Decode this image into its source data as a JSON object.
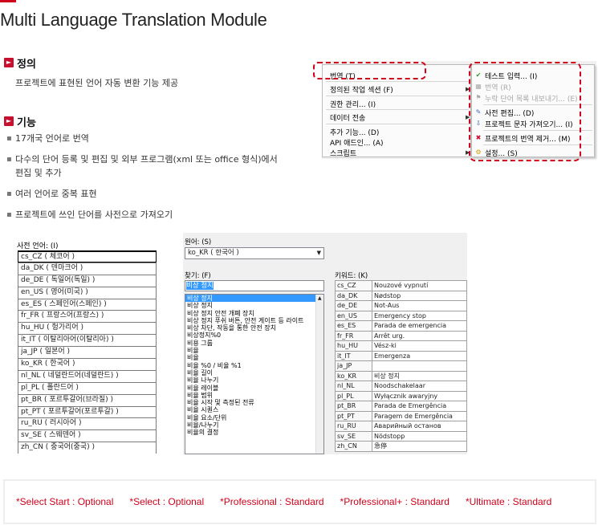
{
  "title": "Multi Language Translation Module",
  "definition": {
    "heading": "정의",
    "text": "프로젝트에 표현된 언어 자동 변환 기능 제공"
  },
  "features": {
    "heading": "기능",
    "items": [
      "17개국 언어로 번역",
      "다수의 단어 등록 및 편집 및 외부 프로그램(xml 또는 office 형식)에서\n편집 및 추가",
      "여러 언어로 중복 표현",
      "프로젝트에 쓰인 단어를 사전으로 가져오기"
    ]
  },
  "menu": {
    "main_items": [
      "번역 (T)",
      "정의된 작업 섹션 (F)",
      "권한 관리... (I)",
      "데이터 전송",
      "추가 기능... (D)",
      "API 애드인... (A)",
      "스크립트"
    ],
    "sub_items": [
      "테스트 입력... (I)",
      "번역 (R)",
      "누락 단어 목록 내보내기... (E)",
      "사전 편집... (D)",
      "프로젝트 문자 가져오기... (I)",
      "프로젝트의 번역 제거... (M)",
      "설정... (S)"
    ]
  },
  "dictionary_languages": {
    "label": "사전 언어: (I)",
    "items": [
      "cs_CZ ( 체코어 )",
      "da_DK ( 덴마크어 )",
      "de_DE ( 독일어(독일) )",
      "en_US ( 영어(미국) )",
      "es_ES ( 스페인어(스페인) )",
      "fr_FR ( 프랑스어(프랑스) )",
      "hu_HU ( 헝가리어 )",
      "it_IT ( 이탈리아어(이탈리아) )",
      "ja_JP ( 일본어 )",
      "ko_KR ( 한국어 )",
      "nl_NL ( 네덜란드어(네덜란드) )",
      "pl_PL ( 폴란드어 )",
      "pt_BR ( 포르투갈어(브라질) )",
      "pt_PT ( 포르투갈어(포르투갈) )",
      "ru_RU ( 러시아어 )",
      "sv_SE ( 스웨덴어 )",
      "zh_CN ( 중국어(중국) )"
    ]
  },
  "dictionary": {
    "source_label": "원어: (S)",
    "source_value": "ko_KR ( 한국어 )",
    "find_label": "찾기: (F)",
    "find_value": "비상 정지",
    "keyword_label": "키워드: (K)",
    "words": [
      "비상 정지",
      "비상 정지",
      "비상 정지 안전 개폐 장치",
      "비상 정지 푸쉬 버튼, 안전 게이트 등 라이트",
      "비상 차단, 작동을 통한 안전 장치",
      "비상정지%0",
      "비용 그룹",
      "비율",
      "비율",
      "비율 %0 / 비율 %1",
      "비율 길이",
      "비율 나누기",
      "비율 레이블",
      "비율 범위",
      "비율 시작 및 측정된 전류",
      "비율 시퀀스",
      "비율 요소/단위",
      "비율/나누기",
      "비율의 결정"
    ],
    "keywords": [
      [
        "cs_CZ",
        "Nouzové vypnutí"
      ],
      [
        "da_DK",
        "Nødstop"
      ],
      [
        "de_DE",
        "Not-Aus"
      ],
      [
        "en_US",
        "Emergency stop"
      ],
      [
        "es_ES",
        "Parada de emergencia"
      ],
      [
        "fr_FR",
        "Arrêt urg."
      ],
      [
        "hu_HU",
        "Vész-ki"
      ],
      [
        "it_IT",
        "Emergenza"
      ],
      [
        "ja_JP",
        ""
      ],
      [
        "ko_KR",
        "비상 정지"
      ],
      [
        "nl_NL",
        "Noodschakelaar"
      ],
      [
        "pl_PL",
        "Wyłącznik awaryjny"
      ],
      [
        "pt_BR",
        "Parada de Emergência"
      ],
      [
        "pt_PT",
        "Paragem de Emergência"
      ],
      [
        "ru_RU",
        "Аварийный останов"
      ],
      [
        "sv_SE",
        "Nödstopp"
      ],
      [
        "zh_CN",
        "急停"
      ]
    ]
  },
  "footer": [
    "*Select Start : Optional",
    "*Select : Optional",
    "*Professional : Standard",
    "*Professional+ : Standard",
    "*Ultimate : Standard"
  ]
}
